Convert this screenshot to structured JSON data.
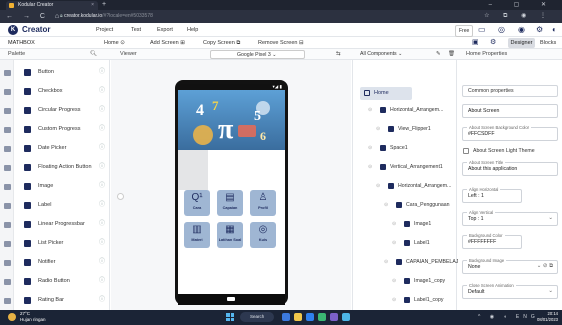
{
  "browser": {
    "tab_title": "Kodular Creator",
    "tab_close": "×",
    "new_tab": "+",
    "window_controls": "– ▢ ✕",
    "nav_buttons": "← → C ⌂",
    "url": "creator.kodular.io",
    "url_rest": "/#?locale=en#5033578",
    "tools": "☆ ⧉ ◉ ⋮"
  },
  "app": {
    "name": "Creator",
    "logo_letter": "K",
    "menu": [
      "Project",
      "Test",
      "Export",
      "Help"
    ],
    "plan": "Free"
  },
  "project_bar": {
    "project_name": "MATHBOX",
    "screen_select": "Home",
    "add_screen": "Add Screen",
    "copy_screen": "Copy Screen",
    "remove_screen": "Remove Screen",
    "designer": "Designer",
    "blocks": "Blocks"
  },
  "columns": {
    "palette": "Palette",
    "viewer": "Viewer",
    "device": "Google Pixel 3",
    "components": "All Components",
    "properties": "Home Properties"
  },
  "palette": {
    "items": [
      {
        "label": "Button"
      },
      {
        "label": "Checkbox"
      },
      {
        "label": "Circular Progress"
      },
      {
        "label": "Custom Progress"
      },
      {
        "label": "Date Picker"
      },
      {
        "label": "Floating Action Button"
      },
      {
        "label": "Image"
      },
      {
        "label": "Label"
      },
      {
        "label": "Linear Progressbar"
      },
      {
        "label": "List Picker"
      },
      {
        "label": "Notifier"
      },
      {
        "label": "Radio Button"
      },
      {
        "label": "Rating Bar"
      }
    ],
    "help_glyph": "ⓘ"
  },
  "phone": {
    "status": "▾◢ ▮",
    "math_text": "4 7 π 5 6",
    "buttons": [
      {
        "icon": "Q¹",
        "label": "Cara"
      },
      {
        "icon": "▤",
        "label": "Capaian"
      },
      {
        "icon": "♙",
        "label": "Profil"
      },
      {
        "icon": "▥",
        "label": "Materi"
      },
      {
        "icon": "▦",
        "label": "Latihan Soal"
      },
      {
        "icon": "◎",
        "label": "Kuis"
      }
    ]
  },
  "components": {
    "items": [
      {
        "label": "Home",
        "indent": 0
      },
      {
        "label": "Horizontal_Arrangem...",
        "indent": 1
      },
      {
        "label": "View_Flipper1",
        "indent": 2
      },
      {
        "label": "Space1",
        "indent": 1
      },
      {
        "label": "Vertical_Arrangement1",
        "indent": 1
      },
      {
        "label": "Horizontal_Arrangem...",
        "indent": 2
      },
      {
        "label": "Cara_Penggunaan",
        "indent": 3
      },
      {
        "label": "Image1",
        "indent": 4
      },
      {
        "label": "Label1",
        "indent": 4
      },
      {
        "label": "CAPAIAN_PEMBELAJ...",
        "indent": 3
      },
      {
        "label": "Image1_copy",
        "indent": 4
      },
      {
        "label": "Label1_copy",
        "indent": 4
      }
    ]
  },
  "properties": {
    "common": "Common properties",
    "about_screen": "About Screen",
    "bg_color_caption": "About Screen Background Color",
    "bg_color_value": "#FFCSDFF",
    "light_theme": "About Screen Light Theme",
    "title_caption": "About Screen Title",
    "title_value": "About this application",
    "align_h_caption": "Align Horizontal",
    "align_h_value": "Left : 1",
    "align_v_caption": "Align Vertical",
    "align_v_value": "Top : 1",
    "bg_caption": "Background Color",
    "bg_value": "#FFFFFFFF",
    "bg_image_caption": "Background Image",
    "bg_image_value": "None",
    "anim_caption": "Close Screen Animation",
    "anim_value": "Default"
  },
  "taskbar": {
    "temp": "27°C",
    "weather": "Hujan ringan",
    "search": "Search",
    "time": "20:14",
    "date": "08/01/2023",
    "tray": "^ ◉ ◖ ENG"
  },
  "colors": {
    "brand": "#1e2b5e",
    "phone_header": "#3a6d9e",
    "button_tile": "#9fb6d3"
  }
}
